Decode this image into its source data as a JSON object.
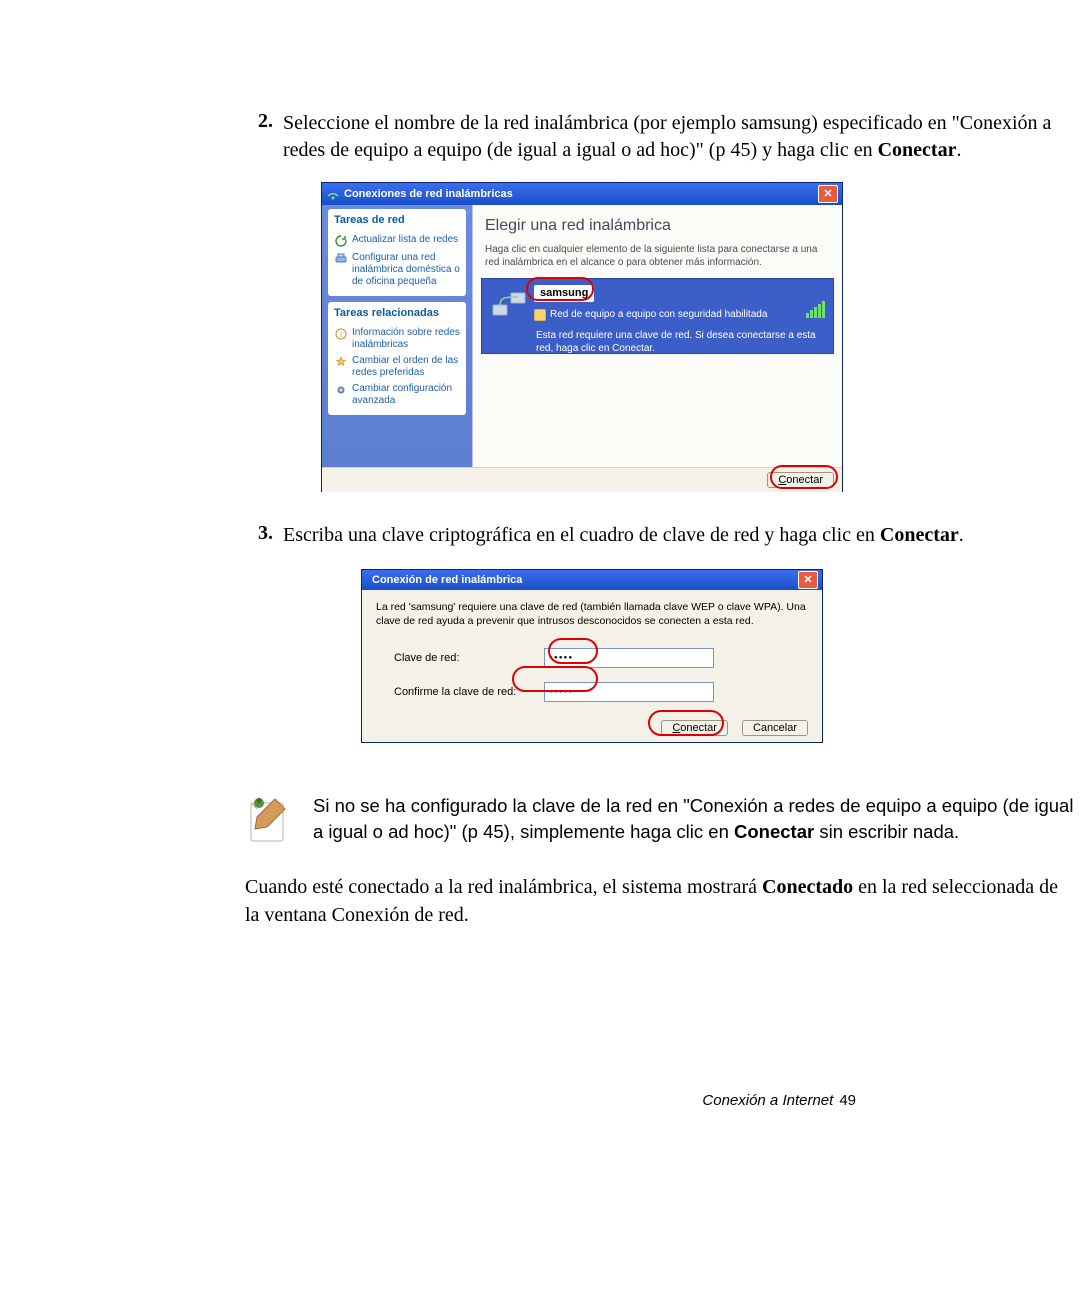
{
  "steps": {
    "s2": {
      "num": "2.",
      "text_a": "Seleccione el nombre de la red inalámbrica (por ejemplo samsung) especificado en \"Conexión a redes de equipo a equipo (de igual a igual o ad hoc)\" (p 45) y haga clic en ",
      "bold": "Conectar",
      "tail": "."
    },
    "s3": {
      "num": "3.",
      "text_a": "Escriba una clave criptográfica en el cuadro de clave de red y haga clic en ",
      "bold": "Conectar",
      "tail": "."
    }
  },
  "shot1": {
    "title": "Conexiones de red inalámbricas",
    "left": {
      "hdr1": "Tareas de red",
      "i1": "Actualizar lista de redes",
      "i2": "Configurar una red inalámbrica doméstica o de oficina pequeña",
      "hdr2": "Tareas relacionadas",
      "i3": "Información sobre redes inalámbricas",
      "i4": "Cambiar el orden de las redes preferidas",
      "i5": "Cambiar configuración avanzada"
    },
    "right": {
      "title": "Elegir una red inalámbrica",
      "sub": "Haga clic en cualquier elemento de la siguiente lista para conectarse a una red inalámbrica en el alcance o para obtener más información.",
      "netname": "samsung",
      "sec": "Red de equipo a equipo con seguridad habilitada",
      "msg": "Esta red requiere una clave de red. Si desea conectarse a esta red, haga clic en Conectar."
    },
    "connect_btn": "Conectar"
  },
  "shot2": {
    "title": "Conexión de red inalámbrica",
    "text": "La red 'samsung' requiere una clave de red (también llamada clave WEP o clave WPA). Una clave de red ayuda a prevenir que intrusos desconocidos se conecten a esta red.",
    "label1": "Clave de red:",
    "label2": "Confirme la clave de red:",
    "dots": "•••••",
    "btn_connect": "Conectar",
    "btn_cancel": "Cancelar"
  },
  "note": {
    "text_a": "Si no se ha configurado la clave de la red en \"Conexión a redes de equipo a equipo (de igual a igual o ad hoc)\" (p 45), simplemente haga clic en ",
    "bold": "Conectar",
    "text_b": " sin escribir nada."
  },
  "closing": {
    "a": "Cuando esté conectado a la red inalámbrica, el sistema mostrará ",
    "bold": "Conectado",
    "b": " en la red seleccionada de la ventana Conexión de red."
  },
  "footer": {
    "section": "Conexión a Internet",
    "page": "49"
  }
}
